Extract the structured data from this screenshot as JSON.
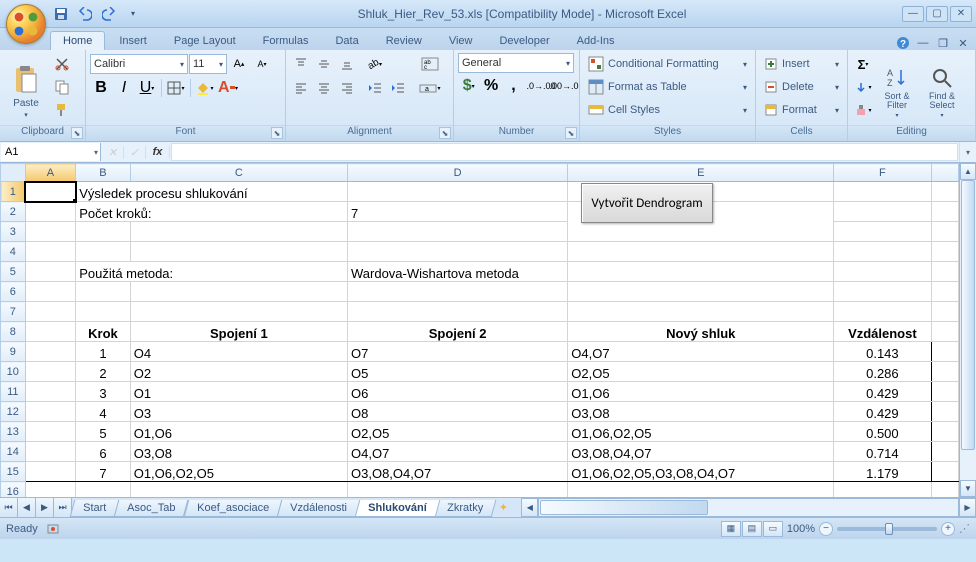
{
  "title": "Shluk_Hier_Rev_53.xls  [Compatibility Mode] - Microsoft Excel",
  "tabs": [
    "Home",
    "Insert",
    "Page Layout",
    "Formulas",
    "Data",
    "Review",
    "View",
    "Developer",
    "Add-Ins"
  ],
  "active_tab": "Home",
  "groups": {
    "clipboard": {
      "label": "Clipboard",
      "paste": "Paste"
    },
    "font": {
      "label": "Font",
      "name": "Calibri",
      "size": "11"
    },
    "alignment": {
      "label": "Alignment"
    },
    "number": {
      "label": "Number",
      "format": "General"
    },
    "styles": {
      "label": "Styles",
      "cond": "Conditional Formatting",
      "table": "Format as Table",
      "cell": "Cell Styles"
    },
    "cells": {
      "label": "Cells",
      "insert": "Insert",
      "delete": "Delete",
      "format": "Format"
    },
    "editing": {
      "label": "Editing",
      "sort": "Sort & Filter",
      "find": "Find & Select"
    }
  },
  "name_box": "A1",
  "columns": [
    "A",
    "B",
    "C",
    "D",
    "E",
    "F"
  ],
  "rows_visible": 17,
  "cells": {
    "B1": "Výsledek procesu shlukování",
    "B2": "Počet kroků:",
    "D2": "7",
    "B5": "Použitá metoda:",
    "D5": "Wardova-Wishartova metoda",
    "dendrogram": "Vytvořit Dendrogram"
  },
  "headers": {
    "B": "Krok",
    "C": "Spojení 1",
    "D": "Spojení 2",
    "E": "Nový shluk",
    "F": "Vzdálenost"
  },
  "data": [
    {
      "krok": "1",
      "s1": "O4",
      "s2": "O7",
      "ns": "O4,O7",
      "vz": "0.143"
    },
    {
      "krok": "2",
      "s1": "O2",
      "s2": "O5",
      "ns": "O2,O5",
      "vz": "0.286"
    },
    {
      "krok": "3",
      "s1": "O1",
      "s2": "O6",
      "ns": "O1,O6",
      "vz": "0.429"
    },
    {
      "krok": "4",
      "s1": "O3",
      "s2": "O8",
      "ns": "O3,O8",
      "vz": "0.429"
    },
    {
      "krok": "5",
      "s1": "O1,O6",
      "s2": "O2,O5",
      "ns": "O1,O6,O2,O5",
      "vz": "0.500"
    },
    {
      "krok": "6",
      "s1": "O3,O8",
      "s2": "O4,O7",
      "ns": "O3,O8,O4,O7",
      "vz": "0.714"
    },
    {
      "krok": "7",
      "s1": "O1,O6,O2,O5",
      "s2": "O3,O8,O4,O7",
      "ns": "O1,O6,O2,O5,O3,O8,O4,O7",
      "vz": "1.179"
    }
  ],
  "sheet_tabs": [
    "Start",
    "Asoc_Tab",
    "Koef_asociace",
    "Vzdálenosti",
    "Shlukování",
    "Zkratky"
  ],
  "active_sheet": "Shlukování",
  "status": "Ready",
  "zoom": "100%",
  "chart_data": {
    "type": "table",
    "title": "Výsledek procesu shlukování",
    "method": "Wardova-Wishartova metoda",
    "step_count": 7,
    "columns": [
      "Krok",
      "Spojení 1",
      "Spojení 2",
      "Nový shluk",
      "Vzdálenost"
    ],
    "rows": [
      [
        1,
        "O4",
        "O7",
        "O4,O7",
        0.143
      ],
      [
        2,
        "O2",
        "O5",
        "O2,O5",
        0.286
      ],
      [
        3,
        "O1",
        "O6",
        "O1,O6",
        0.429
      ],
      [
        4,
        "O3",
        "O8",
        "O3,O8",
        0.429
      ],
      [
        5,
        "O1,O6",
        "O2,O5",
        "O1,O6,O2,O5",
        0.5
      ],
      [
        6,
        "O3,O8",
        "O4,O7",
        "O3,O8,O4,O7",
        0.714
      ],
      [
        7,
        "O1,O6,O2,O5",
        "O3,O8,O4,O7",
        "O1,O6,O2,O5,O3,O8,O4,O7",
        1.179
      ]
    ]
  }
}
